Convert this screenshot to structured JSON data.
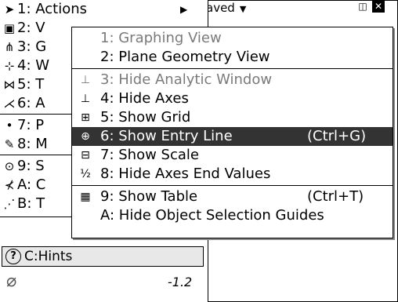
{
  "header": {
    "status_text": "aved",
    "dropdown_icon": "triangle-down-icon",
    "icons": [
      "page-icon",
      "close-icon"
    ]
  },
  "main_menu": {
    "items": [
      {
        "label": "1: Actions",
        "icon": "arrow-pointer-icon",
        "has_submenu": true
      },
      {
        "label": "2: V",
        "icon": "view-icon"
      },
      {
        "label": "3: G",
        "icon": "graph-icon"
      },
      {
        "label": "4: W",
        "icon": "window-icon"
      },
      {
        "label": "5: T",
        "icon": "trace-icon"
      },
      {
        "label": "6: A",
        "icon": "analyze-icon"
      },
      {
        "label": "7: P",
        "icon": "point-icon"
      },
      {
        "label": "8: M",
        "icon": "measure-icon"
      },
      {
        "label": "9: S",
        "icon": "shapes-icon"
      },
      {
        "label": "A: C",
        "icon": "construction-icon"
      },
      {
        "label": "B: T",
        "icon": "transform-icon"
      }
    ],
    "hints": {
      "label": "C:Hints",
      "icon": "question-icon"
    }
  },
  "submenu": {
    "items": [
      {
        "label": "1: Graphing View",
        "disabled": true,
        "icon": ""
      },
      {
        "label": "2: Plane Geometry View",
        "disabled": false,
        "icon": ""
      },
      {
        "label": "3: Hide Analytic Window",
        "disabled": true,
        "icon": "axes-corner-icon"
      },
      {
        "label": "4: Hide Axes",
        "disabled": false,
        "icon": "axes-icon"
      },
      {
        "label": "5: Show Grid",
        "disabled": false,
        "icon": "grid-icon"
      },
      {
        "label": "6: Show Entry Line",
        "shortcut": "(Ctrl+G)",
        "selected": true,
        "icon": "entry-line-icon"
      },
      {
        "label": "7: Show Scale",
        "icon": "scale-icon"
      },
      {
        "label": "8: Hide Axes End Values",
        "icon": "end-values-icon"
      },
      {
        "label": "9: Show Table",
        "shortcut": "(Ctrl+T)",
        "icon": "table-icon"
      },
      {
        "label": "A: Hide Object Selection Guides",
        "icon": ""
      }
    ]
  },
  "graph": {
    "tick_value": "-1.2",
    "tool_icon": "slash-icon"
  }
}
